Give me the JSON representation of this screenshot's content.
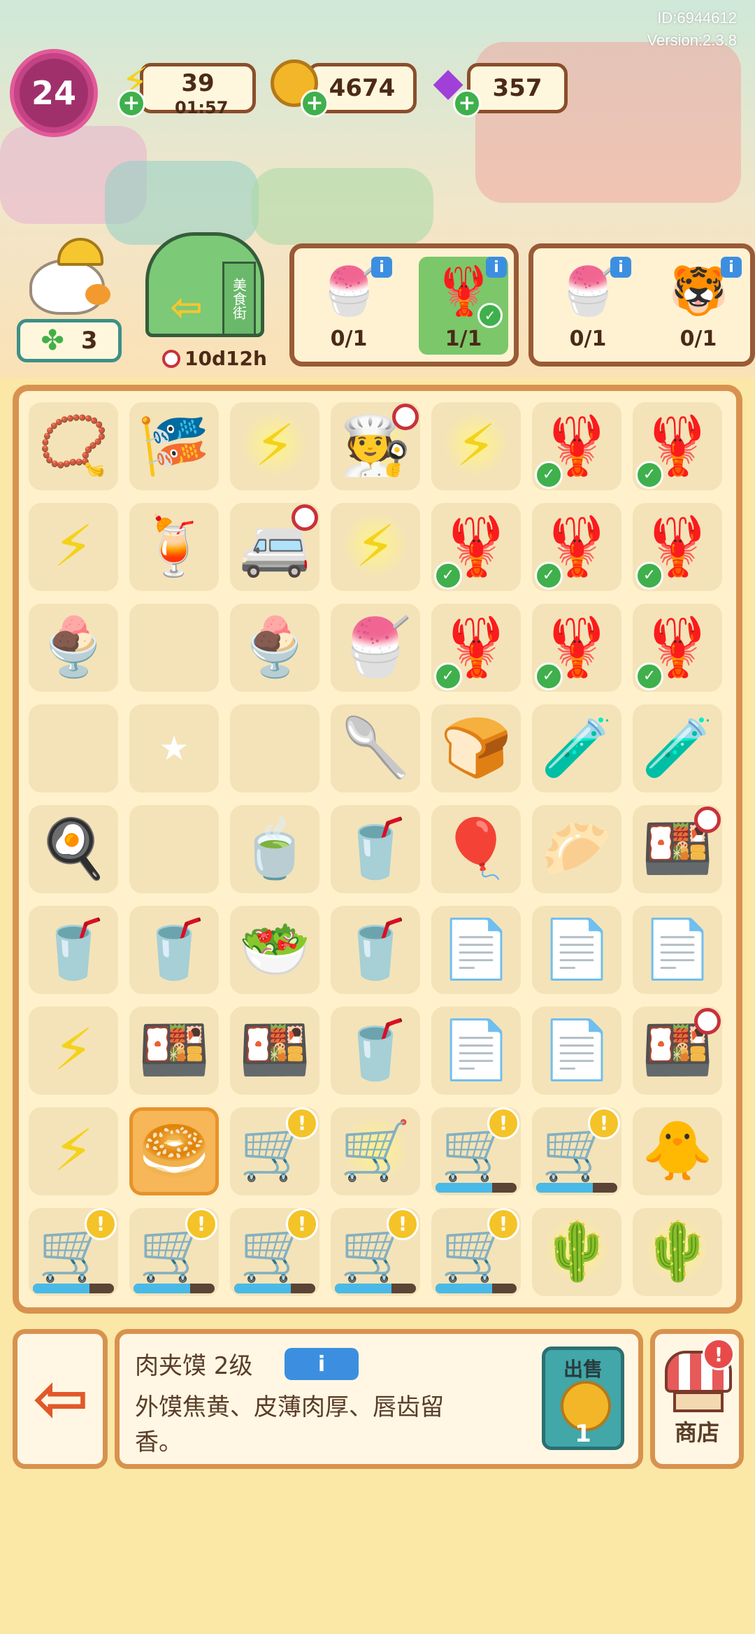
{
  "meta": {
    "id_text": "ID:6944612",
    "version_text": "Version:2.3.8"
  },
  "header": {
    "level": "24",
    "energy": {
      "value": "39",
      "timer": "01:57",
      "icon": "lightning-icon"
    },
    "coins": {
      "value": "4674",
      "icon": "coin-icon"
    },
    "gems": {
      "value": "357",
      "icon": "gem-icon"
    }
  },
  "character": {
    "clover_count": "3"
  },
  "street_gate": {
    "sign": "美食街",
    "timer": "10d12h"
  },
  "orders": [
    {
      "items": [
        {
          "food": "🍧",
          "count": "0/1",
          "done": false
        },
        {
          "food": "🦞",
          "count": "1/1",
          "done": true
        }
      ]
    },
    {
      "items": [
        {
          "food": "🍧",
          "count": "0/1",
          "done": false
        },
        {
          "food": "🐯",
          "count": "0/1",
          "done": false
        }
      ]
    }
  ],
  "board": {
    "progress_fill": 0.7,
    "rows": [
      [
        "📿",
        "🎏",
        "⚡",
        "🧑‍🍳",
        "⚡",
        "🦞",
        "🦞"
      ],
      [
        "⚡",
        "🍹",
        "🚐",
        "⚡",
        "🦞",
        "🦞",
        "🦞"
      ],
      [
        "🍨",
        "",
        "🍨",
        "🍧",
        "🦞",
        "🦞",
        "🦞"
      ],
      [
        "",
        "★",
        "",
        "🥄",
        "🍞",
        "🧪",
        "🧪"
      ],
      [
        "🍳",
        "",
        "🍵",
        "🥤",
        "🎈",
        "🥟",
        "🍱"
      ],
      [
        "🥤",
        "🥤",
        "🥗",
        "🥤",
        "📄",
        "📄",
        "📄"
      ],
      [
        "⚡",
        "🍱",
        "🍱",
        "🥤",
        "📄",
        "📄",
        "🍱"
      ],
      [
        "⚡",
        "🥯",
        "🛒",
        "🛒",
        "🛒",
        "🛒",
        "🐥"
      ],
      [
        "🛒",
        "🛒",
        "🛒",
        "🛒",
        "🛒",
        "🌵",
        "🌵"
      ]
    ],
    "checks": [
      [
        0,
        5
      ],
      [
        0,
        6
      ],
      [
        1,
        4
      ],
      [
        1,
        5
      ],
      [
        1,
        6
      ],
      [
        2,
        4
      ],
      [
        2,
        5
      ],
      [
        2,
        6
      ]
    ],
    "alerts": [
      [
        7,
        2
      ],
      [
        7,
        4
      ],
      [
        7,
        5
      ],
      [
        8,
        0
      ],
      [
        8,
        1
      ],
      [
        8,
        2
      ],
      [
        8,
        3
      ],
      [
        8,
        4
      ]
    ],
    "clocks": [
      [
        0,
        3
      ],
      [
        1,
        2
      ],
      [
        4,
        6
      ],
      [
        6,
        6
      ]
    ],
    "bars": [
      [
        7,
        4
      ],
      [
        7,
        5
      ],
      [
        8,
        0
      ],
      [
        8,
        1
      ],
      [
        8,
        2
      ],
      [
        8,
        3
      ],
      [
        8,
        4
      ]
    ],
    "glows": [
      [
        0,
        2
      ],
      [
        0,
        3
      ],
      [
        0,
        4
      ],
      [
        1,
        3
      ],
      [
        7,
        3
      ],
      [
        8,
        5
      ],
      [
        8,
        6
      ]
    ],
    "selected": [
      7,
      1
    ]
  },
  "description": {
    "title": "肉夹馍 2级",
    "info_label": "i",
    "text": "外馍焦黄、皮薄肉厚、唇齿留香。",
    "sell_label": "出售",
    "sell_price": "1"
  },
  "shop": {
    "label": "商店",
    "alert": "!"
  },
  "icons": {
    "exit": "exit-icon",
    "info": "info-icon",
    "check": "check-icon",
    "alert": "alert-icon",
    "clock": "clock-icon"
  },
  "colors": {
    "board_border": "#d8924f",
    "board_bg": "#fff1cc",
    "level_badge": "#a0306c",
    "sell_button": "#41a7a9",
    "check": "#3fb04b",
    "alert": "#f4c327"
  }
}
